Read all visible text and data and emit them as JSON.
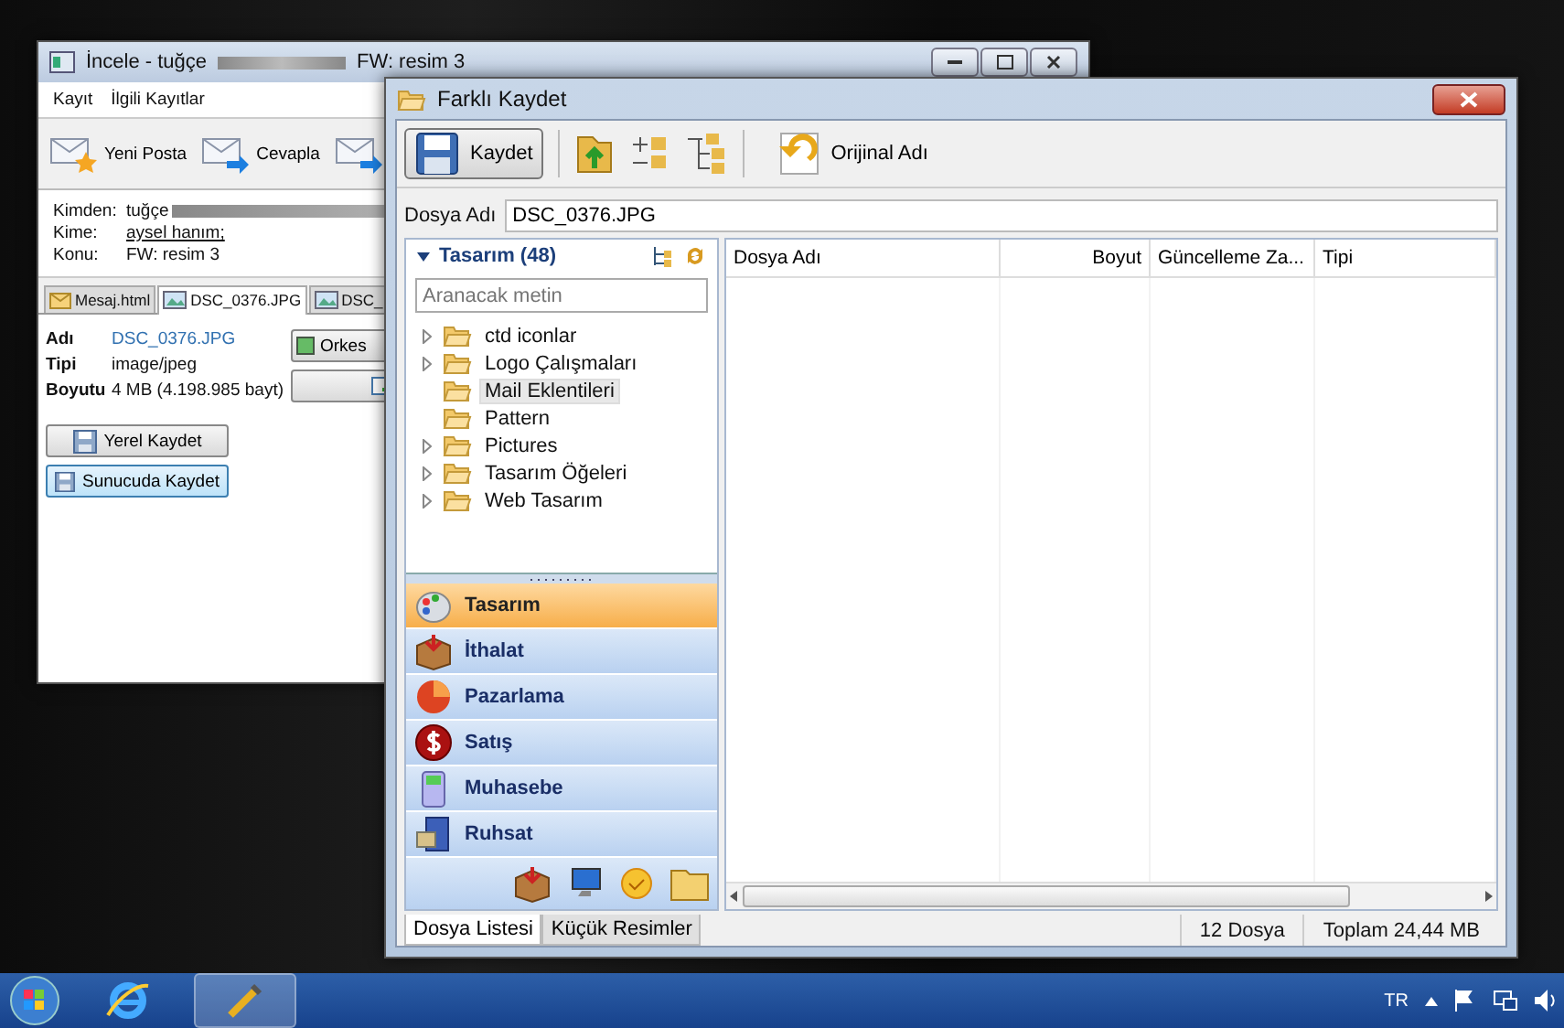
{
  "back_window": {
    "title": "İncele - tuğçe",
    "title_suffix": "FW: resim 3",
    "menu": [
      "Kayıt",
      "İlgili Kayıtlar"
    ],
    "toolbar": [
      "Yeni Posta",
      "Cevapla"
    ],
    "fields": [
      {
        "label": "Kimden:",
        "value": "tuğçe",
        "kind": "redacted"
      },
      {
        "label": "Kime:",
        "value": "aysel hanım;",
        "kind": "link"
      },
      {
        "label": "Konu:",
        "value": "FW: resim 3",
        "kind": "plain"
      }
    ],
    "tabs": [
      {
        "label": "Mesaj.html",
        "selected": false
      },
      {
        "label": "DSC_0376.JPG",
        "selected": true
      },
      {
        "label": "DSC_",
        "selected": false
      }
    ],
    "attachment": [
      {
        "label": "Adı",
        "value": "DSC_0376.JPG"
      },
      {
        "label": "Tipi",
        "value": "image/jpeg"
      },
      {
        "label": "Boyutu",
        "value": "4 MB (4.198.985 bayt)"
      }
    ],
    "side_button": "Orkes",
    "buttons": [
      {
        "label": "Yerel Kaydet",
        "selected": false
      },
      {
        "label": "Sunucuda Kaydet",
        "selected": true
      }
    ]
  },
  "dialog": {
    "title": "Farklı Kaydet",
    "save": "Kaydet",
    "original_name": "Orijinal Adı",
    "filename": {
      "label": "Dosya Adı",
      "value": "DSC_0376.JPG"
    },
    "folder_panel": {
      "title": "Tasarım (48)",
      "search_placeholder": "Aranacak metin",
      "tree": [
        {
          "label": "ctd iconlar",
          "expandable": true,
          "selected": false
        },
        {
          "label": "Logo Çalışmaları",
          "expandable": true,
          "selected": false
        },
        {
          "label": "Mail Eklentileri",
          "expandable": false,
          "selected": true
        },
        {
          "label": "Pattern",
          "expandable": false,
          "selected": false
        },
        {
          "label": "Pictures",
          "expandable": true,
          "selected": false
        },
        {
          "label": "Tasarım Öğeleri",
          "expandable": true,
          "selected": false
        },
        {
          "label": "Web Tasarım",
          "expandable": true,
          "selected": false
        }
      ]
    },
    "nav": [
      {
        "label": "Tasarım",
        "selected": true
      },
      {
        "label": "İthalat",
        "selected": false
      },
      {
        "label": "Pazarlama",
        "selected": false
      },
      {
        "label": "Satış",
        "selected": false
      },
      {
        "label": "Muhasebe",
        "selected": false
      },
      {
        "label": "Ruhsat",
        "selected": false
      }
    ],
    "columns": [
      "Dosya Adı",
      "Boyut",
      "Güncelleme Za...",
      "Tipi"
    ],
    "status_tabs": [
      {
        "label": "Dosya Listesi",
        "selected": true
      },
      {
        "label": "Küçük Resimler",
        "selected": false
      }
    ],
    "file_count": "12 Dosya",
    "total": "Toplam 24,44 MB"
  },
  "taskbar": {
    "language": "TR"
  }
}
